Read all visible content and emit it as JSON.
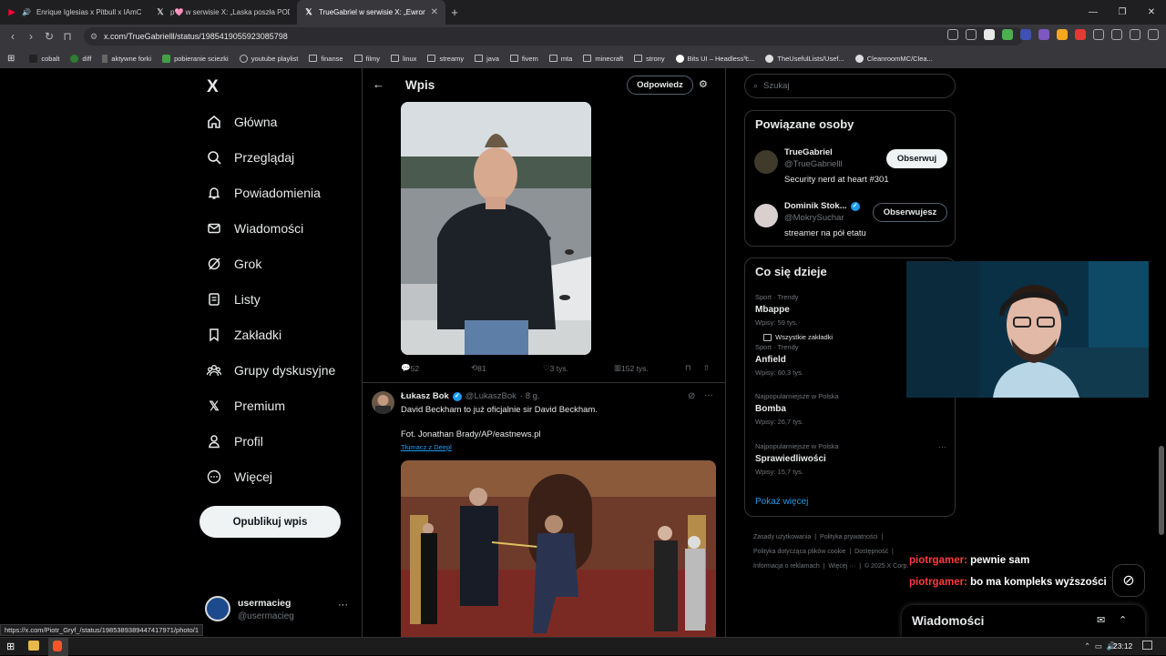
{
  "browser": {
    "tabs": [
      {
        "title": "Enrique Iglesias x Pitbull x IAmCh",
        "icon": "youtube-icon",
        "active": false
      },
      {
        "title": "p🩷 w serwisie X: „Laska poszła POD",
        "icon": "x-icon",
        "active": false
      },
      {
        "title": "TrueGabriel w serwisie X: „Ewron",
        "icon": "x-icon",
        "active": true
      }
    ],
    "new_tab": "+",
    "url": "x.com/TrueGabrielll/status/1985419055923085798",
    "bookmarks": [
      "cobalt",
      "diff",
      "aktywne forki",
      "pobieranie sciezki",
      "youtube playlist",
      "finanse",
      "filmy",
      "linux",
      "streamy",
      "java",
      "fivem",
      "mta",
      "minecraft",
      "strony",
      "Bits UI – Headless c...",
      "TheUsefulLists/Usef...",
      "CleanroomMC/Clea..."
    ],
    "bookmarks_more": "»",
    "all_bookmarks": "Wszystkie zakładki",
    "status_url": "https://x.com/Piotr_Gryf_/status/1985389389447417971/photo/1"
  },
  "sidebar": {
    "logo": "X",
    "items": [
      {
        "label": "Główna",
        "icon": "home-icon"
      },
      {
        "label": "Przeglądaj",
        "icon": "search-icon"
      },
      {
        "label": "Powiadomienia",
        "icon": "bell-icon"
      },
      {
        "label": "Wiadomości",
        "icon": "mail-icon"
      },
      {
        "label": "Grok",
        "icon": "grok-icon"
      },
      {
        "label": "Listy",
        "icon": "list-icon"
      },
      {
        "label": "Zakładki",
        "icon": "bookmark-icon"
      },
      {
        "label": "Grupy dyskusyjne",
        "icon": "communities-icon"
      },
      {
        "label": "Premium",
        "icon": "x-premium-icon"
      },
      {
        "label": "Profil",
        "icon": "profile-icon"
      },
      {
        "label": "Więcej",
        "icon": "more-icon"
      }
    ],
    "post_button": "Opublikuj wpis",
    "account": {
      "name": "usermacieg",
      "handle": "@usermacieg",
      "more": "···"
    }
  },
  "main": {
    "header_title": "Wpis",
    "reply_button": "Odpowiedz",
    "tweet1_stats": {
      "replies": "52",
      "reposts": "81",
      "likes": "3 tys.",
      "views": "152 tys."
    },
    "tweet2": {
      "author": "Łukasz Bok",
      "handle": "@LukaszBok",
      "time": "· 8 g.",
      "text": "David Beckham to już oficjalnie sir David Beckham.\n\nFot. Jonathan Brady/AP/eastnews.pl",
      "translate": "Tłumacz z Deepl"
    }
  },
  "right": {
    "search_placeholder": "Szukaj",
    "related_title": "Powiązane osoby",
    "people": [
      {
        "name": "TrueGabriel",
        "handle": "@TrueGabrielll",
        "bio": "Security nerd at heart #301",
        "button": "Obserwuj",
        "verified": false
      },
      {
        "name": "Dominik Stok...",
        "handle": "@MokrySuchar",
        "bio": "streamer na pół etatu",
        "button": "Obserwujesz",
        "verified": true
      }
    ],
    "trends_title": "Co się dzieje",
    "trends": [
      {
        "category": "Sport · Trendy",
        "name": "Mbappe",
        "posts": "Wpisy: 59 tys."
      },
      {
        "category": "Sport · Trendy",
        "name": "Anfield",
        "posts": "Wpisy: 60,3 tys."
      },
      {
        "category": "Najpopularniejsze w Polska",
        "name": "Bomba",
        "posts": "Wpisy: 26,7 tys."
      },
      {
        "category": "Najpopularniejsze w Polska",
        "name": "Sprawiedliwości",
        "posts": "Wpisy: 15,7 tys."
      }
    ],
    "show_more": "Pokaż więcej",
    "footer": [
      "Zasady użytkowania",
      "Polityka prywatności",
      "Polityka dotycząca plików cookie",
      "Dostępność",
      "Informacja o reklamach",
      "Więcej ···",
      "© 2025 X Corp."
    ]
  },
  "overlay": {
    "chat": [
      {
        "user": "piotrgamer:",
        "message": "pewnie sam"
      },
      {
        "user": "piotrgamer:",
        "message": "bo ma kompleks wyższości"
      }
    ],
    "messages_bar": "Wiadomości"
  },
  "taskbar": {
    "time": "23:12"
  },
  "colors": {
    "accent": "#1d9bf0",
    "background": "#000000",
    "border": "#2f3336",
    "muted": "#71767b",
    "chat_user": "#ff3b3b"
  }
}
